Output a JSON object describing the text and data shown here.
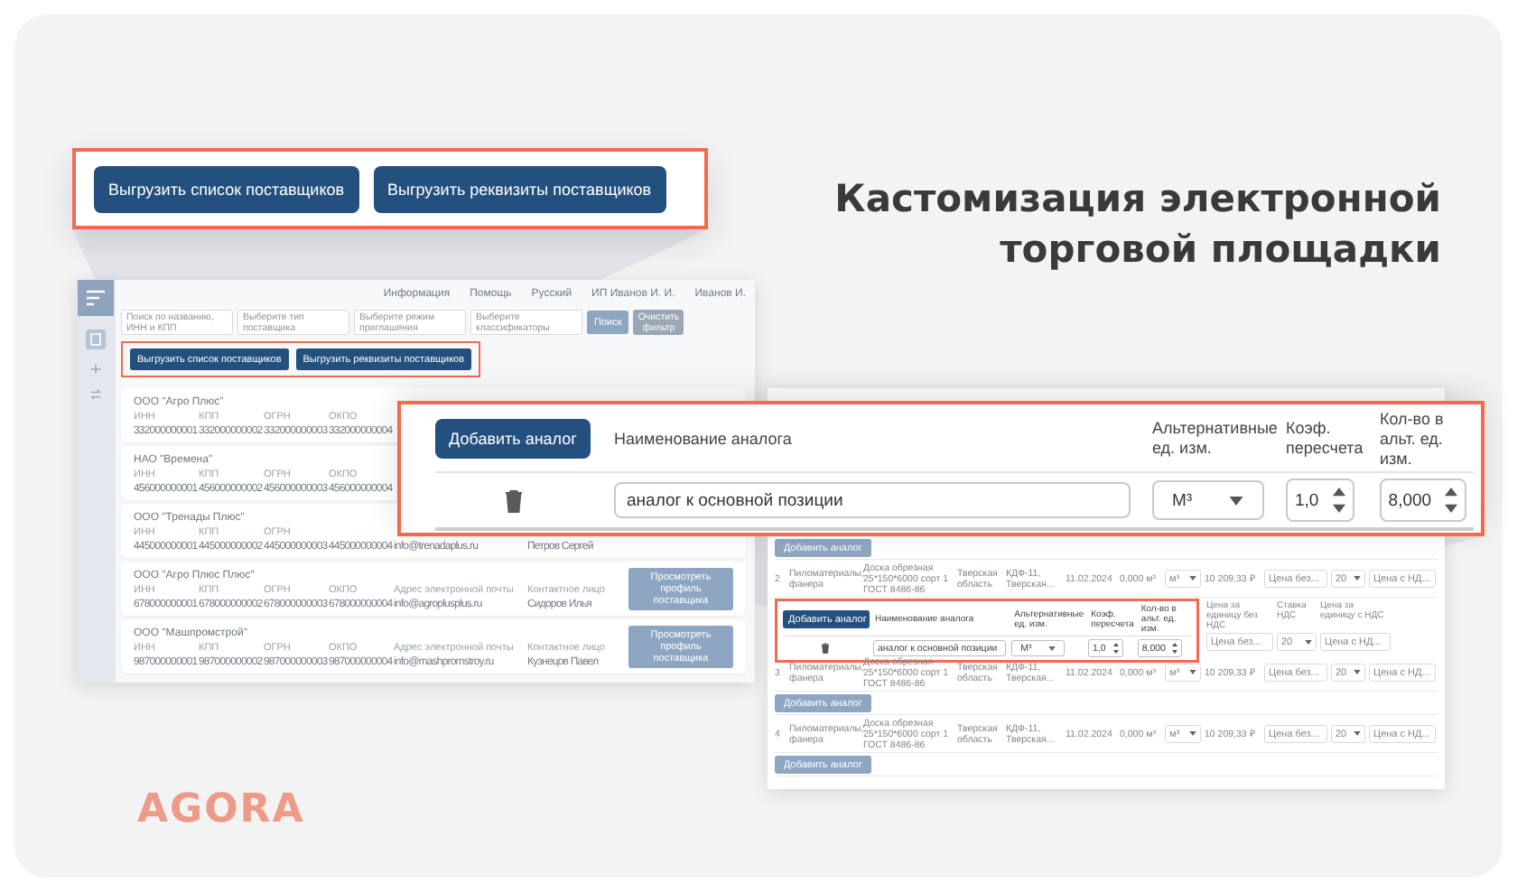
{
  "headline": [
    "Кастомизация электронной",
    "торговой площадки"
  ],
  "export_callout": {
    "buttons": [
      "Выгрузить список поставщиков",
      "Выгрузить реквизиты поставщиков"
    ]
  },
  "analog_callout": {
    "add_button": "Добавить аналог",
    "columns": [
      "Наименование аналога",
      "Альтернативные ед. изм.",
      "Коэф. пересчета",
      "Кол-во в альт. ед. изм."
    ],
    "row": {
      "name": "аналог к основной позиции",
      "unit": "М³",
      "factor": "1,0",
      "quantity": "8,000"
    }
  },
  "suppliers_screen": {
    "menu": [
      "Информация",
      "Помощь",
      "Русский",
      "ИП Иванов И. И.",
      "Иванов И."
    ],
    "filters": [
      {
        "placeholder": "Поиск по названию, ИНН и КПП"
      },
      {
        "placeholder": "Выберите тип поставщика"
      },
      {
        "placeholder": "Выберите режим приглашения"
      },
      {
        "placeholder": "Выберите классификаторы"
      }
    ],
    "search_button": "Поиск",
    "clear_button": "Очистить фильтр",
    "export_buttons": [
      "Выгрузить список поставщиков",
      "Выгрузить реквизиты поставщиков"
    ],
    "suppliers": [
      {
        "name": "ООО \"Агро Плюс\"",
        "fields": [
          {
            "label": "ИНН",
            "value": "332000000001"
          },
          {
            "label": "КПП",
            "value": "332000000002"
          },
          {
            "label": "ОГРН",
            "value": "332000000003"
          },
          {
            "label": "ОКПО",
            "value": "332000000004"
          }
        ]
      },
      {
        "name": "НАО \"Времена\"",
        "fields": [
          {
            "label": "ИНН",
            "value": "456000000001"
          },
          {
            "label": "КПП",
            "value": "456000000002"
          },
          {
            "label": "ОГРН",
            "value": "456000000003"
          },
          {
            "label": "ОКПО",
            "value": "456000000004"
          }
        ]
      },
      {
        "name": "ООО \"Тренады Плюс\"",
        "fields": [
          {
            "label": "ИНН",
            "value": "445000000001"
          },
          {
            "label": "КПП",
            "value": "445000000002"
          },
          {
            "label": "ОГРН",
            "value": "445000000003"
          },
          {
            "value": "445000000004"
          },
          {
            "value": "info@trenadaplus.ru"
          },
          {
            "value": "Петров Сергей"
          }
        ]
      },
      {
        "name": "ООО \"Агро Плюс Плюс\"",
        "fields": [
          {
            "label": "ИНН",
            "value": "678000000001"
          },
          {
            "label": "КПП",
            "value": "678000000002"
          },
          {
            "label": "ОГРН",
            "value": "678000000003"
          },
          {
            "label": "ОКПО",
            "value": "678000000004"
          },
          {
            "label": "Адрес электронной почты",
            "value": "info@agroplusplus.ru"
          },
          {
            "label": "Контактное лицо",
            "value": "Сидоров Илья"
          }
        ],
        "button": "Просмотреть профиль поставщика"
      },
      {
        "name": "ООО \"Машпромстрой\"",
        "fields": [
          {
            "label": "ИНН",
            "value": "987000000001"
          },
          {
            "label": "КПП",
            "value": "987000000002"
          },
          {
            "label": "ОГРН",
            "value": "987000000003"
          },
          {
            "label": "ОКПО",
            "value": "987000000004"
          },
          {
            "label": "Адрес электронной почты",
            "value": "info@mashpromstroy.ru"
          },
          {
            "label": "Контактное лицо",
            "value": "Кузнецов Павел"
          }
        ],
        "button": "Просмотреть профиль поставщика"
      }
    ]
  },
  "offers_screen": {
    "items": [
      {
        "kind": "add",
        "label": "Добавить аналог"
      },
      {
        "kind": "row",
        "cells": [
          "2",
          "Пиломатериалы, фанера",
          "Доска обрезная 25*150*6000 сорт 1 ГОСТ 8486-86",
          "Тверская область",
          "КДФ-11, Тверская...",
          "11.02.2024",
          "0,000 м³"
        ],
        "unit": "м³",
        "price": "10 209,33 ₽",
        "price_net": "Цена без...",
        "vat": "20",
        "price_gross": "Цена с НД..."
      },
      {
        "kind": "analog",
        "add_button": "Добавить аналог",
        "columns": [
          "Наименование аналога",
          "Альтернативные ед. изм.",
          "Коэф. пересчета",
          "Кол-во в альт. ед. изм."
        ],
        "extra_columns": [
          "Цена за единицу без НДС",
          "Ставка НДС",
          "Цена за единицу с НДС"
        ],
        "row": {
          "name": "аналог к основной позиции",
          "unit": "М³",
          "factor": "1,0",
          "quantity": "8,000",
          "price_net": "Цена без...",
          "vat": "20",
          "price_gross": "Цена с НД..."
        }
      },
      {
        "kind": "row",
        "cells": [
          "3",
          "Пиломатериалы, фанера",
          "Доска обрезная 25*150*6000 сорт 1 ГОСТ 8486-86",
          "Тверская область",
          "КДФ-11, Тверская...",
          "11.02.2024",
          "0,000 м³"
        ],
        "unit": "м³",
        "price": "10 209,33 ₽",
        "price_net": "Цена без...",
        "vat": "20",
        "price_gross": "Цена с НД..."
      },
      {
        "kind": "add",
        "label": "Добавить аналог"
      },
      {
        "kind": "row",
        "cells": [
          "4",
          "Пиломатериалы, фанера",
          "Доска обрезная 25*150*6000 сорт 1 ГОСТ 8486-86",
          "Тверская область",
          "КДФ-11, Тверская...",
          "11.02.2024",
          "0,000 м³"
        ],
        "unit": "м³",
        "price": "10 209,33 ₽",
        "price_net": "Цена без...",
        "vat": "20",
        "price_gross": "Цена с НД..."
      },
      {
        "kind": "add",
        "label": "Добавить аналог"
      }
    ]
  },
  "brand": "AGORA"
}
